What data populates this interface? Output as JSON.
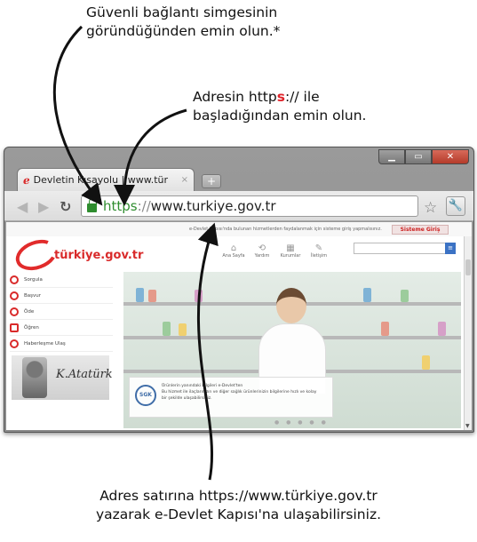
{
  "callouts": {
    "secure_icon": [
      "Güvenli bağlantı simgesinin",
      "göründüğünden emin olun.*"
    ],
    "https_prefix": "Adresin http",
    "https_s": "s",
    "https_rest": ":// ile",
    "https_line2": "başladığından emin olun.",
    "bottom": [
      "Adres satırına https://www.türkiye.gov.tr",
      "yazarak e-Devlet Kapısı'na ulaşabilirsiniz."
    ]
  },
  "browser": {
    "tab_title": "Devletin Kısayolu | www.tür",
    "tab_close": "×",
    "new_tab": "+",
    "url": {
      "scheme": "https",
      "sep": "://",
      "host": "www.turkiye.gov.tr"
    },
    "icons": [
      "back-icon",
      "forward-icon",
      "reload-icon",
      "lock-icon",
      "star-icon",
      "wrench-icon"
    ],
    "colors": {
      "secure": "#2f8d2f",
      "brand": "#d92a2a"
    }
  },
  "site": {
    "logo_text": "türkiye.gov.tr",
    "login_button": "Sisteme Giriş",
    "top_note": "e-Devlet Kapısı'nda bulunan hizmetlerden faydalanmak için sisteme giriş yapmalısınız.",
    "topnav": [
      "Ana Sayfa",
      "Yardım",
      "Kurumlar",
      "İletişim"
    ],
    "sidebar": [
      "Sorgula",
      "Başvur",
      "Öde",
      "Öğren",
      "Haberleşme Ulaş"
    ],
    "hero_caption_title": "Ürünlerin yanındaki bilgileri e-Devlet'ten",
    "hero_caption_body": "Bu hizmet ile ilaçlarınızın ve diğer sağlık ürünlerinizin bilgilerine hızlı ve kolay bir şekilde ulaşabilirsiniz.",
    "sgk": "SGK"
  }
}
